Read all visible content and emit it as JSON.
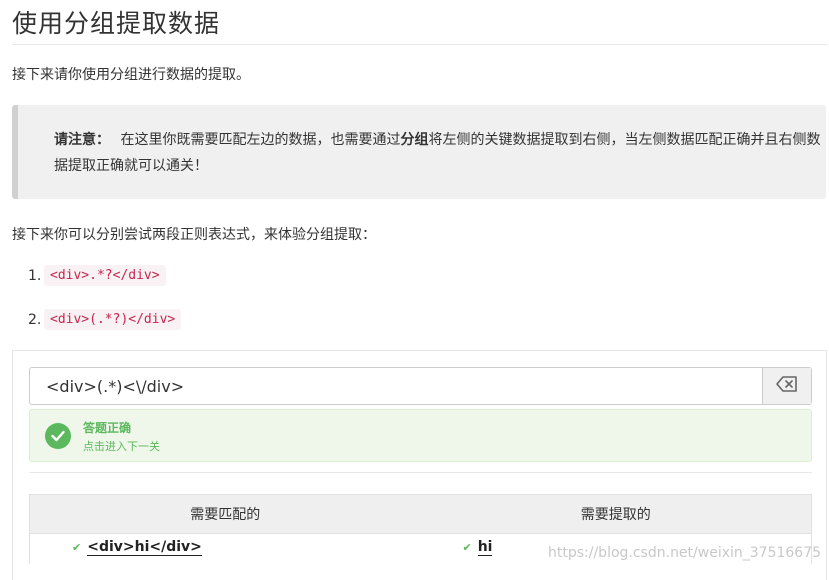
{
  "page": {
    "title": "使用分组提取数据",
    "intro": "接下来请你使用分组进行数据的提取。",
    "callout": {
      "label": "请注意：",
      "text_before": "在这里你既需要匹配左边的数据，也需要通过",
      "emphasis": "分组",
      "text_after": "将左侧的关键数据提取到右侧，当左侧数据匹配正确并且右侧数据提取正确就可以通关！"
    },
    "lead": "接下来你可以分别尝试两段正则表达式，来体验分组提取：",
    "examples": [
      {
        "num": "1.",
        "code": "<div>.*?</div>"
      },
      {
        "num": "2.",
        "code": "<div>(.*?)</div>"
      }
    ]
  },
  "exercise": {
    "input_value": "<div>(.*)<\\/div>",
    "clear_icon": "backspace-icon",
    "success_title": "答题正确",
    "success_sub": "点击进入下一关",
    "table": {
      "headers": [
        "需要匹配的",
        "需要提取的"
      ],
      "rows": [
        {
          "match": "<div>hi</div>",
          "extract": "hi"
        }
      ]
    }
  },
  "watermark": "https://blog.csdn.net/weixin_37516675",
  "colors": {
    "success": "#5cb85c",
    "code_text": "#c7254e",
    "code_bg": "#f9f2f4"
  }
}
